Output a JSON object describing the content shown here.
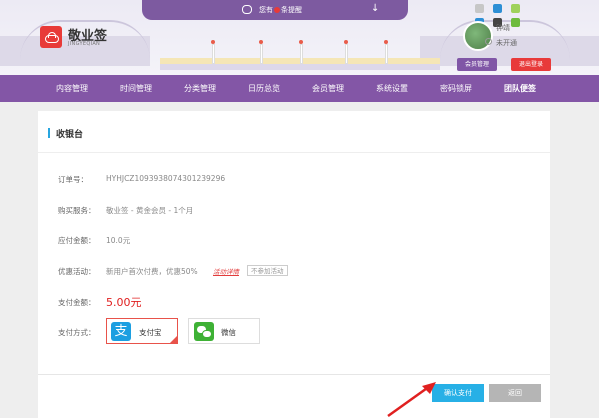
{
  "header": {
    "logo_text": "敬业签",
    "logo_sub": "JINGYEQIAN",
    "notice_prefix": "您有",
    "notice_suffix": "条提醒",
    "user_name": "钟靖",
    "user_status": "未开通",
    "member_button": "会员管理",
    "logout_button": "退出登录"
  },
  "nav": {
    "items": [
      {
        "label": "内容管理"
      },
      {
        "label": "时间管理"
      },
      {
        "label": "分类管理"
      },
      {
        "label": "日历总览"
      },
      {
        "label": "会员管理"
      },
      {
        "label": "系统设置"
      },
      {
        "label": "密码锁屏"
      },
      {
        "label": "团队便签"
      }
    ],
    "active_index": 7
  },
  "cashier": {
    "title": "收银台",
    "order_label": "订单号：",
    "order_value": "HYHJCZ1093938074301239296",
    "service_label": "购买服务：",
    "service_value": "敬业签 - 黄金会员 - 1个月",
    "payable_label": "应付金额：",
    "payable_value": "10.0元",
    "promo_label": "优惠活动：",
    "promo_value": "新用户首次付费，优惠50%",
    "promo_link": "活动详情",
    "promo_button": "不参加活动",
    "pay_amount_label": "支付金额：",
    "pay_amount_value": "5.00元",
    "method_label": "支付方式：",
    "methods": [
      {
        "label": "支付宝",
        "icon": "alipay-icon",
        "selected": true
      },
      {
        "label": "微信",
        "icon": "wechat-icon",
        "selected": false
      }
    ],
    "confirm_button": "确认支付",
    "back_button": "返回"
  },
  "colors": {
    "nav_purple": "#8356a6",
    "accent_blue": "#27b0e6",
    "price_red": "#e02020",
    "logo_red": "#e83a38"
  }
}
